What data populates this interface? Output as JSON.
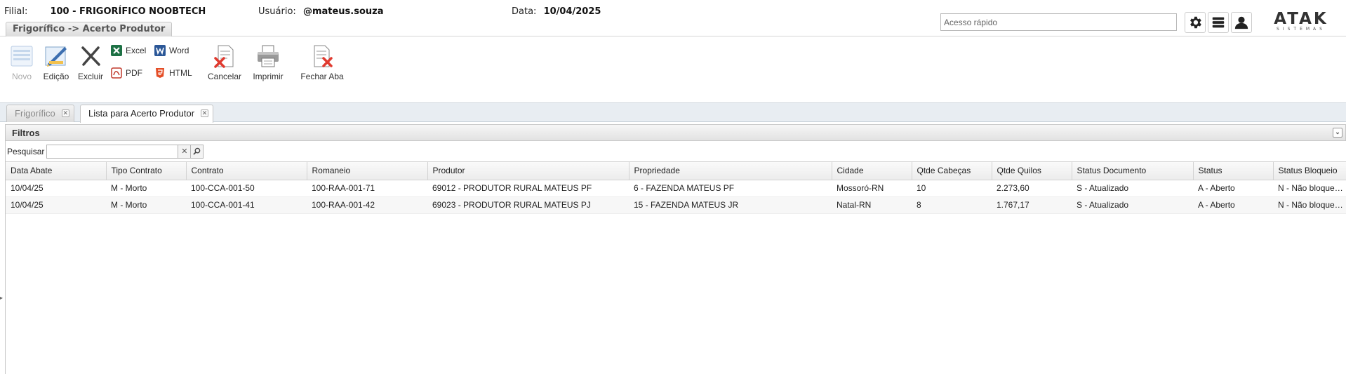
{
  "header": {
    "filial_label": "Filial:",
    "filial_value": "100 - FRIGORÍFICO NOOBTECH",
    "usuario_label": "Usuário:",
    "usuario_value": "@mateus.souza",
    "data_label": "Data:",
    "data_value": "10/04/2025",
    "breadcrumb": "Frigorífico -> Acerto Produtor",
    "quick_access_placeholder": "Acesso rápido",
    "logo_text": "ATAK",
    "logo_sub": "SISTEMAS"
  },
  "toolbar": {
    "novo": "Novo",
    "edicao": "Edição",
    "excluir": "Excluir",
    "excel": "Excel",
    "word": "Word",
    "pdf": "PDF",
    "html": "HTML",
    "cancelar": "Cancelar",
    "imprimir": "Imprimir",
    "fechar_aba": "Fechar Aba"
  },
  "tabs": [
    {
      "label": "Frigorífico"
    },
    {
      "label": "Lista para Acerto Produtor"
    }
  ],
  "filters": {
    "title": "Filtros",
    "search_label": "Pesquisar",
    "search_value": ""
  },
  "table": {
    "columns": [
      "Data Abate",
      "Tipo Contrato",
      "Contrato",
      "Romaneio",
      "Produtor",
      "Propriedade",
      "Cidade",
      "Qtde Cabeças",
      "Qtde Quilos",
      "Status Documento",
      "Status",
      "Status Bloqueio"
    ],
    "rows": [
      [
        "10/04/25",
        "M - Morto",
        "100-CCA-001-50",
        "100-RAA-001-71",
        "69012 - PRODUTOR RURAL MATEUS PF",
        "6 - FAZENDA MATEUS PF",
        "Mossoró-RN",
        "10",
        "2.273,60",
        "S - Atualizado",
        "A - Aberto",
        "N - Não bloqueado"
      ],
      [
        "10/04/25",
        "M - Morto",
        "100-CCA-001-41",
        "100-RAA-001-42",
        "69023 - PRODUTOR RURAL MATEUS PJ",
        "15 - FAZENDA MATEUS JR",
        "Natal-RN",
        "8",
        "1.767,17",
        "S - Atualizado",
        "A - Aberto",
        "N - Não bloqueado"
      ]
    ]
  }
}
